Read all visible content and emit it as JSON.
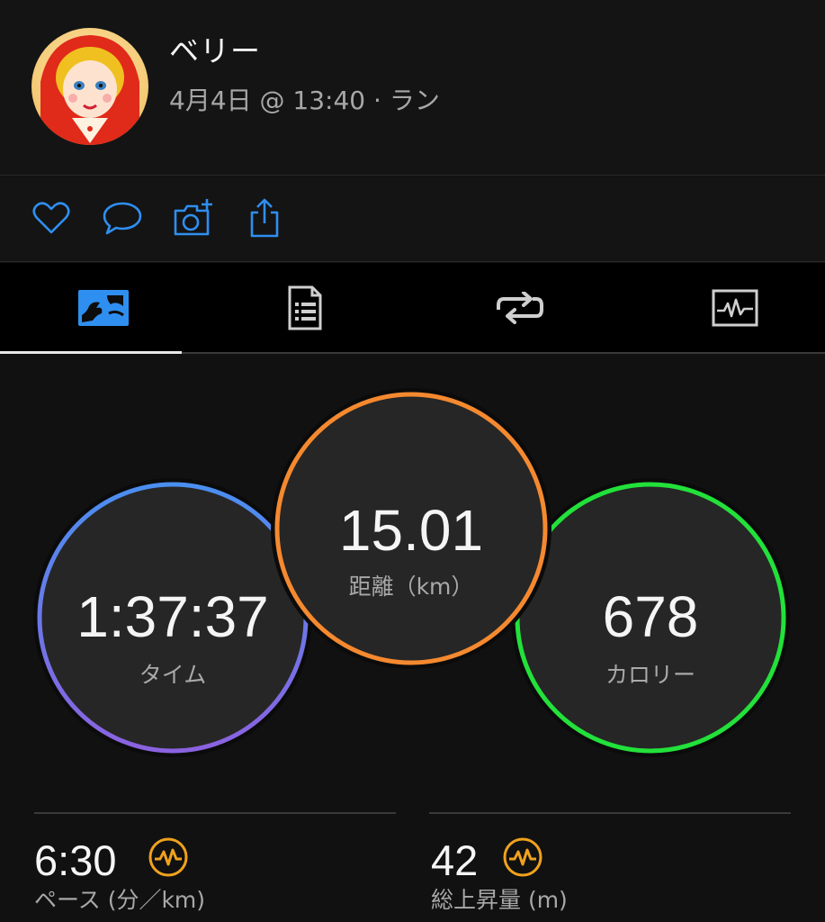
{
  "header": {
    "username": "ベリー",
    "meta": "4月4日 @ 13:40 · ラン"
  },
  "actions": {
    "icons": [
      "heart-icon",
      "comment-icon",
      "camera-add-icon",
      "share-icon"
    ],
    "accent": "#2f8ff0"
  },
  "tabs": {
    "icons": [
      "map-icon",
      "details-list-icon",
      "laps-icon",
      "chart-icon"
    ],
    "active": 0
  },
  "rings": {
    "time": {
      "value": "1:37:37",
      "label": "タイム",
      "color_start": "#4a8ff0",
      "color_end": "#8b62e0"
    },
    "distance": {
      "value": "15.01",
      "label": "距離（km）",
      "color": "#f5892f"
    },
    "calories": {
      "value": "678",
      "label": "カロリー",
      "color": "#22e13a"
    }
  },
  "stats": {
    "pace": {
      "value": "6:30",
      "label": "ペース (分／km)"
    },
    "ascent": {
      "value": "42",
      "label": "総上昇量 (m)"
    },
    "badge_color": "#f0a21d"
  }
}
